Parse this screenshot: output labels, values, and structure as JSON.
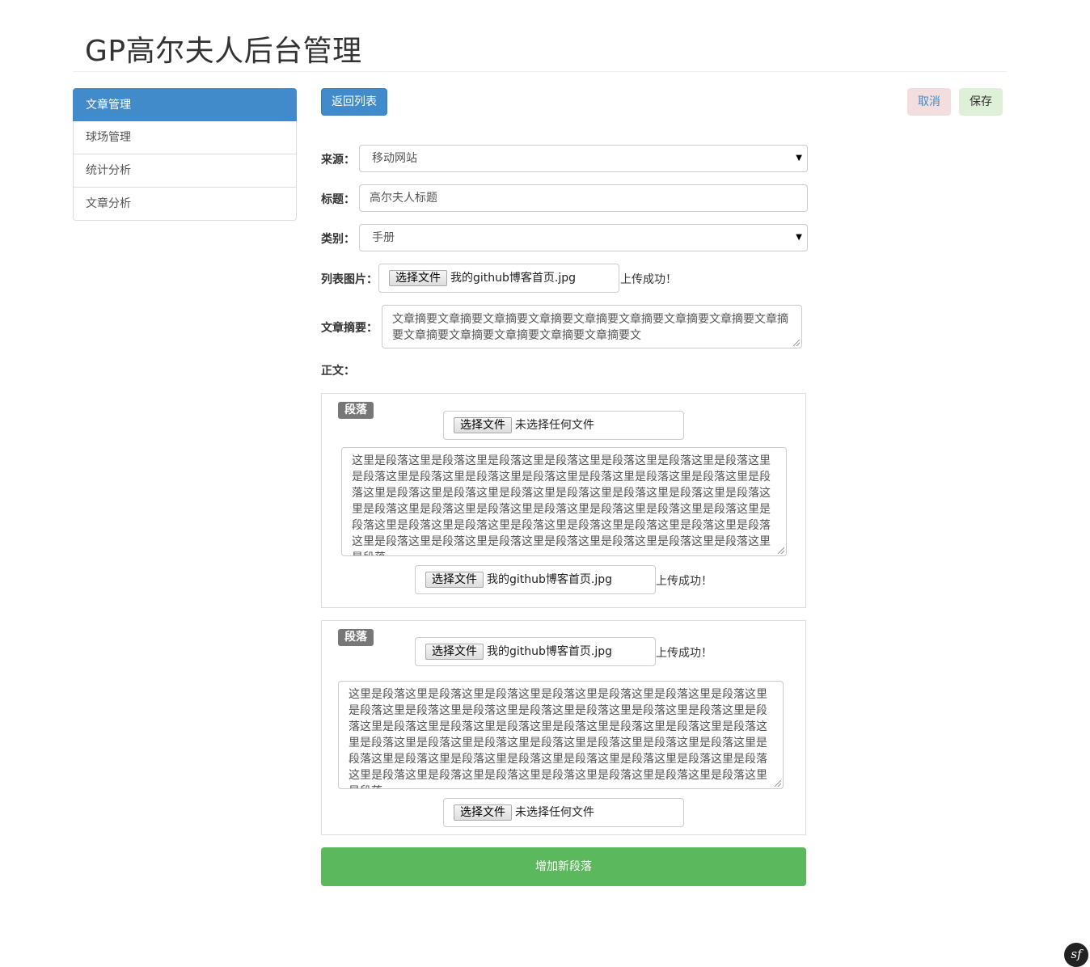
{
  "header": {
    "title": "GP高尔夫人后台管理"
  },
  "sidebar": {
    "items": [
      {
        "label": "文章管理",
        "active": true
      },
      {
        "label": "球场管理",
        "active": false
      },
      {
        "label": "统计分析",
        "active": false
      },
      {
        "label": "文章分析",
        "active": false
      }
    ]
  },
  "toolbar": {
    "back_label": "返回列表",
    "cancel_label": "取消",
    "save_label": "保存"
  },
  "form": {
    "source": {
      "label": "来源：",
      "value": "移动网站"
    },
    "title": {
      "label": "标题：",
      "value": "高尔夫人标题"
    },
    "category": {
      "label": "类别：",
      "value": "手册"
    },
    "list_image": {
      "label": "列表图片：",
      "button": "选择文件",
      "file_name": "我的github博客首页.jpg",
      "status": "上传成功！"
    },
    "summary": {
      "label": "文章摘要：",
      "value": "文章摘要文章摘要文章摘要文章摘要文章摘要文章摘要文章摘要文章摘要文章摘要文章摘要文章摘要文章摘要文章摘要文章摘要文"
    },
    "body_label": "正文："
  },
  "paragraphs": [
    {
      "badge": "段落",
      "top_file": {
        "button": "选择文件",
        "file_name": "未选择任何文件"
      },
      "text": "这里是段落这里是段落这里是段落这里是段落这里是段落这里是段落这里是段落这里是段落这里是段落这里是段落这里是段落这里是段落这里是段落这里是段落这里是段落这里是段落这里是段落这里是段落这里是段落这里是段落这里是段落这里是段落这里是段落这里是段落这里是段落这里是段落这里是段落这里是段落这里是段落这里是段落这里是段落这里是段落这里是段落这里是段落这里是段落这里是段落这里是段落这里是段落这里是段落这里是段落这里是段落这里是段落这里是段落这里是段落这里是段落",
      "bottom_file": {
        "button": "选择文件",
        "file_name": "我的github博客首页.jpg",
        "status": "上传成功！"
      }
    },
    {
      "badge": "段落",
      "top_file": {
        "button": "选择文件",
        "file_name": "我的github博客首页.jpg",
        "status": "上传成功！"
      },
      "text": "这里是段落这里是段落这里是段落这里是段落这里是段落这里是段落这里是段落这里是段落这里是段落这里是段落这里是段落这里是段落这里是段落这里是段落这里是段落这里是段落这里是段落这里是段落这里是段落这里是段落这里是段落这里是段落这里是段落这里是段落这里是段落这里是段落这里是段落这里是段落这里是段落这里是段落这里是段落这里是段落这里是段落这里是段落这里是段落这里是段落这里是段落这里是段落这里是段落这里是段落这里是段落这里是段落这里是段落这里是段落这里是段落",
      "bottom_file": {
        "button": "选择文件",
        "file_name": "未选择任何文件"
      }
    }
  ],
  "add_paragraph_label": "增加新段落",
  "footer": {
    "symfony_icon": "symfony-icon",
    "symfony_text": "sf"
  }
}
